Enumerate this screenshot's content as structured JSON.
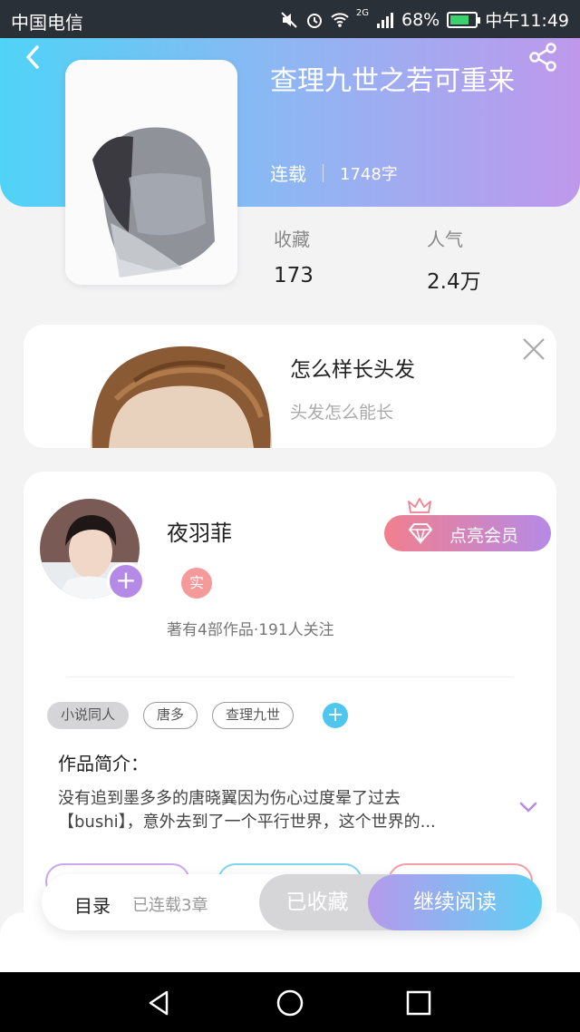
{
  "status_bar": {
    "carrier": "中国电信",
    "network": "2G",
    "battery": "68%",
    "time": "中午11:49"
  },
  "book": {
    "title": "查理九世之若可重来",
    "status": "连载",
    "word_count": "1748字"
  },
  "stats": [
    {
      "label": "收藏",
      "value": "173"
    },
    {
      "label": "人气",
      "value": "2.4万"
    }
  ],
  "ad": {
    "title": "怎么样长头发",
    "subtitle": "头发怎么能长"
  },
  "author": {
    "name": "夜羽菲",
    "badge": "实",
    "info": "著有4部作品·191人关注",
    "vip_button": "点亮会员"
  },
  "tags": [
    "小说同人",
    "唐多",
    "查理九世"
  ],
  "intro": {
    "title": "作品简介：",
    "line1": "没有追到墨多多的唐晓翼因为伤心过度晕了过去",
    "line2": "【bushi】，意外去到了一个平行世界，这个世界的..."
  },
  "action_bar": {
    "toc_label": "目录",
    "toc_count": "已连载3章",
    "collected_label": "已收藏",
    "read_label": "继续阅读"
  },
  "colors": {
    "accent_start": "#4fd3f6",
    "accent_end": "#bf98ec",
    "vip_start": "#f27f8e"
  },
  "icons": [
    "back-icon",
    "share-icon",
    "close-icon",
    "plus-icon",
    "diamond-icon",
    "crown-icon",
    "chevron-down-icon",
    "nav-back-icon",
    "nav-home-icon",
    "nav-recents-icon"
  ]
}
